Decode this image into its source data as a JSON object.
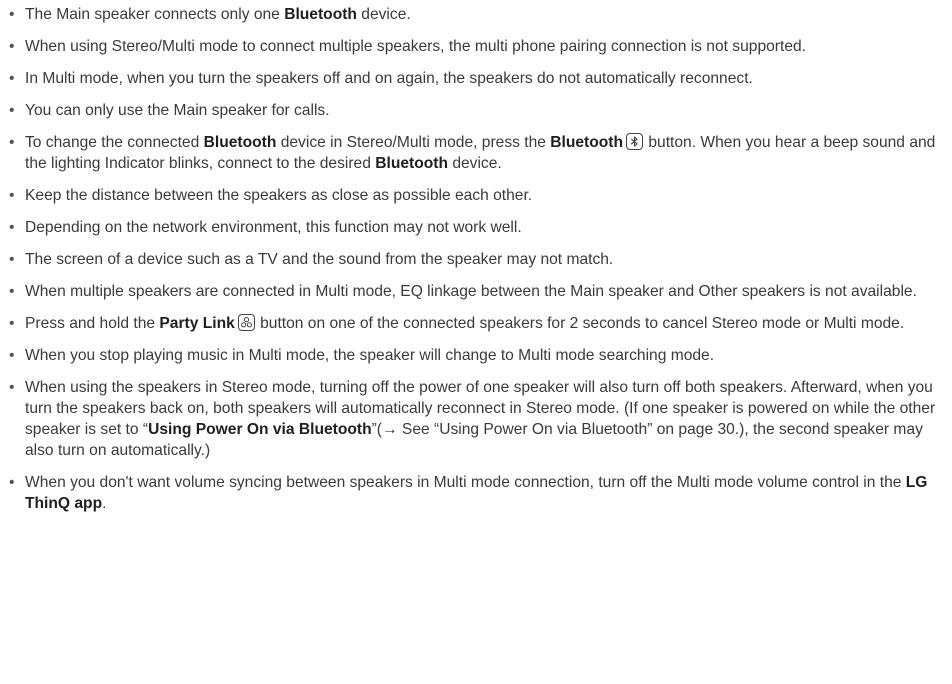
{
  "notes": [
    {
      "segments": [
        {
          "t": "The Main speaker connects only one "
        },
        {
          "t": "Bluetooth",
          "b": true
        },
        {
          "t": " device."
        }
      ]
    },
    {
      "segments": [
        {
          "t": "When using Stereo/Multi mode to connect multiple speakers, the multi phone pairing connection is not supported."
        }
      ]
    },
    {
      "segments": [
        {
          "t": "In Multi mode, when you turn the speakers off and on again, the speakers do not automatically reconnect."
        }
      ]
    },
    {
      "segments": [
        {
          "t": "You can only use the Main speaker for calls."
        }
      ]
    },
    {
      "segments": [
        {
          "t": "To change the connected "
        },
        {
          "t": "Bluetooth",
          "b": true
        },
        {
          "t": " device in Stereo/Multi mode, press the "
        },
        {
          "t": "Bluetooth",
          "b": true
        },
        {
          "icon": "bluetooth-icon"
        },
        {
          "t": " button. When you hear a beep sound and the lighting Indicator blinks, connect to the desired "
        },
        {
          "t": "Bluetooth",
          "b": true
        },
        {
          "t": " device."
        }
      ]
    },
    {
      "segments": [
        {
          "t": "Keep the distance between the speakers as close as possible each other."
        }
      ]
    },
    {
      "segments": [
        {
          "t": "Depending on the network environment, this function may not work well."
        }
      ]
    },
    {
      "segments": [
        {
          "t": "The screen of a device such as a TV and the sound from the speaker may not match."
        }
      ]
    },
    {
      "segments": [
        {
          "t": "When multiple speakers are connected in Multi mode, EQ linkage between the Main speaker and Other speakers is not available."
        }
      ]
    },
    {
      "segments": [
        {
          "t": "Press and hold the "
        },
        {
          "t": "Party Link",
          "b": true
        },
        {
          "icon": "party-link-icon"
        },
        {
          "t": " button on one of the connected speakers for 2 seconds to cancel Stereo mode or Multi mode."
        }
      ]
    },
    {
      "segments": [
        {
          "t": "When you stop playing music in Multi mode, the speaker will change to Multi mode searching mode."
        }
      ]
    },
    {
      "segments": [
        {
          "t": "When using the speakers in Stereo mode, turning off the power of one speaker will also turn off both speakers. Afterward, when you turn the speakers back on, both speakers will automatically reconnect in Stereo mode. (If one speaker is powered on while the other speaker is set to “"
        },
        {
          "t": "Using Power On via Bluetooth",
          "b": true
        },
        {
          "t": "”(→ See “Using Power On via Bluetooth” on page 30.), the second speaker may also turn on automatically.)"
        }
      ]
    },
    {
      "segments": [
        {
          "t": "When you don't want volume syncing between speakers in Multi mode connection, turn off the Multi mode volume control in the "
        },
        {
          "t": "LG ThinQ app",
          "b": true
        },
        {
          "t": "."
        }
      ]
    }
  ]
}
